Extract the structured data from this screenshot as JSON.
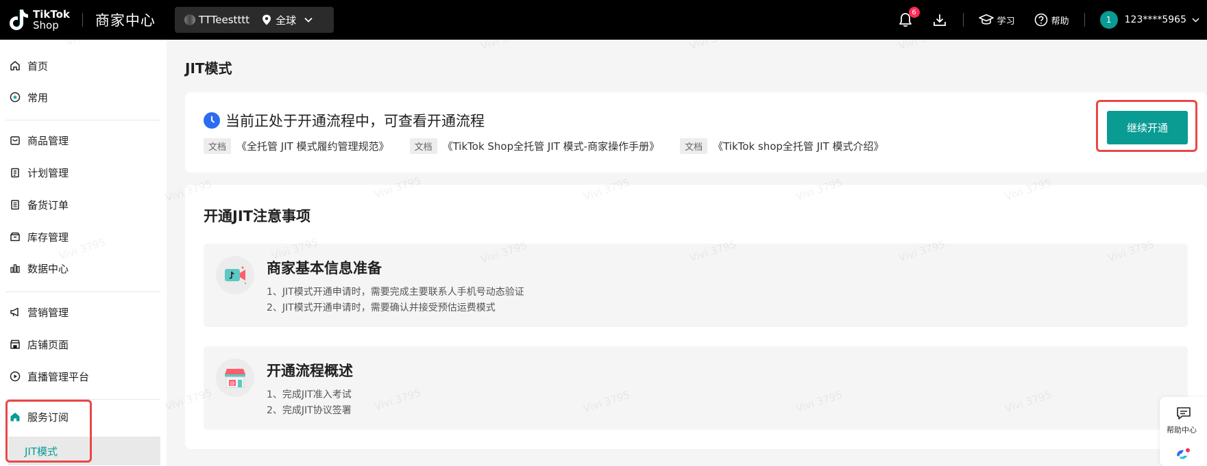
{
  "header": {
    "logo_line1": "TikTok",
    "logo_line2": "Shop",
    "app_title": "商家中心",
    "shop_name": "TTTeestttt",
    "region": "全球",
    "notification_count": "6",
    "learn_label": "学习",
    "help_label": "帮助",
    "user_initial": "1",
    "user_name": "123****5965"
  },
  "sidebar": {
    "items": [
      {
        "label": "首页",
        "icon": "home-icon"
      },
      {
        "label": "常用",
        "icon": "star-icon"
      },
      {
        "label": "商品管理",
        "icon": "product-icon"
      },
      {
        "label": "计划管理",
        "icon": "clipboard-icon"
      },
      {
        "label": "备货订单",
        "icon": "document-icon"
      },
      {
        "label": "库存管理",
        "icon": "inventory-icon"
      },
      {
        "label": "数据中心",
        "icon": "chart-icon"
      },
      {
        "label": "营销管理",
        "icon": "megaphone-icon"
      },
      {
        "label": "店铺页面",
        "icon": "store-icon"
      },
      {
        "label": "直播管理平台",
        "icon": "live-icon"
      },
      {
        "label": "服务订阅",
        "icon": "service-home-icon"
      }
    ],
    "sub_item": "JIT模式"
  },
  "main": {
    "page_title": "JIT模式",
    "status_text": "当前正处于开通流程中，可查看开通流程",
    "doc_tag": "文档",
    "docs": [
      "《全托管 JIT 模式履约管理规范》",
      "《TikTok Shop全托管 JIT 模式-商家操作手册》",
      "《TikTok shop全托管 JIT 模式介绍》"
    ],
    "continue_button": "继续开通",
    "section_title": "开通JIT注意事项",
    "notices": [
      {
        "title": "商家基本信息准备",
        "lines": [
          "1、JIT模式开通申请时，需要完成主要联系人手机号动态验证",
          "2、JIT模式开通申请时，需要确认并接受预估运费模式"
        ]
      },
      {
        "title": "开通流程概述",
        "lines": [
          "1、完成JIT准入考试",
          "2、完成JIT协议签署"
        ]
      }
    ]
  },
  "help_center": "帮助中心",
  "watermark": "Vivi 3795",
  "colors": {
    "accent": "#0a9b93",
    "highlight": "#ea4646",
    "badge": "#fe2c55",
    "clock": "#2d6cf0"
  }
}
